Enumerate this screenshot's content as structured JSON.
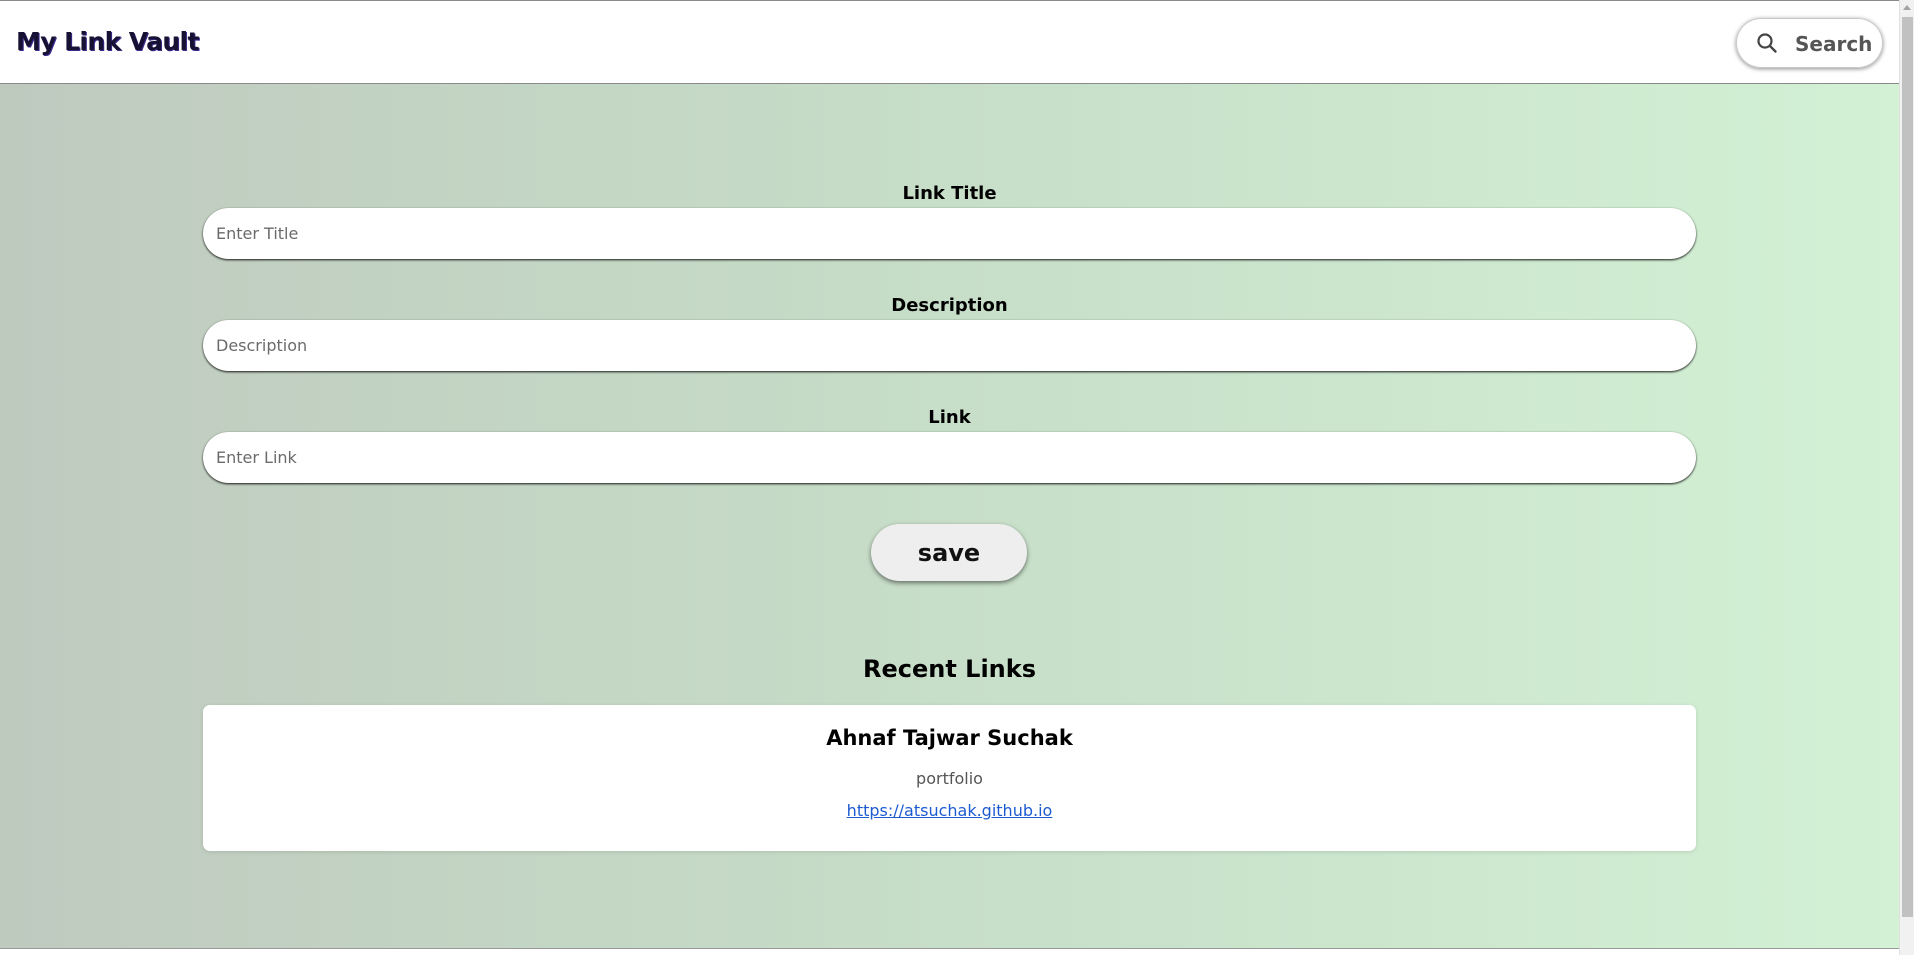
{
  "header": {
    "brand": "My Link Vault",
    "search_label": "Search"
  },
  "form": {
    "title_label": "Link Title",
    "title_placeholder": "Enter Title",
    "description_label": "Description",
    "description_placeholder": "Description",
    "link_label": "Link",
    "link_placeholder": "Enter Link",
    "save_label": "save"
  },
  "recent": {
    "heading": "Recent Links",
    "items": [
      {
        "title": "Ahnaf Tajwar Suchak",
        "description": "portfolio",
        "url": "https://atsuchak.github.io"
      }
    ]
  },
  "icons": {
    "search": "search-icon",
    "scroll_up": "scroll-up-arrow-icon"
  }
}
